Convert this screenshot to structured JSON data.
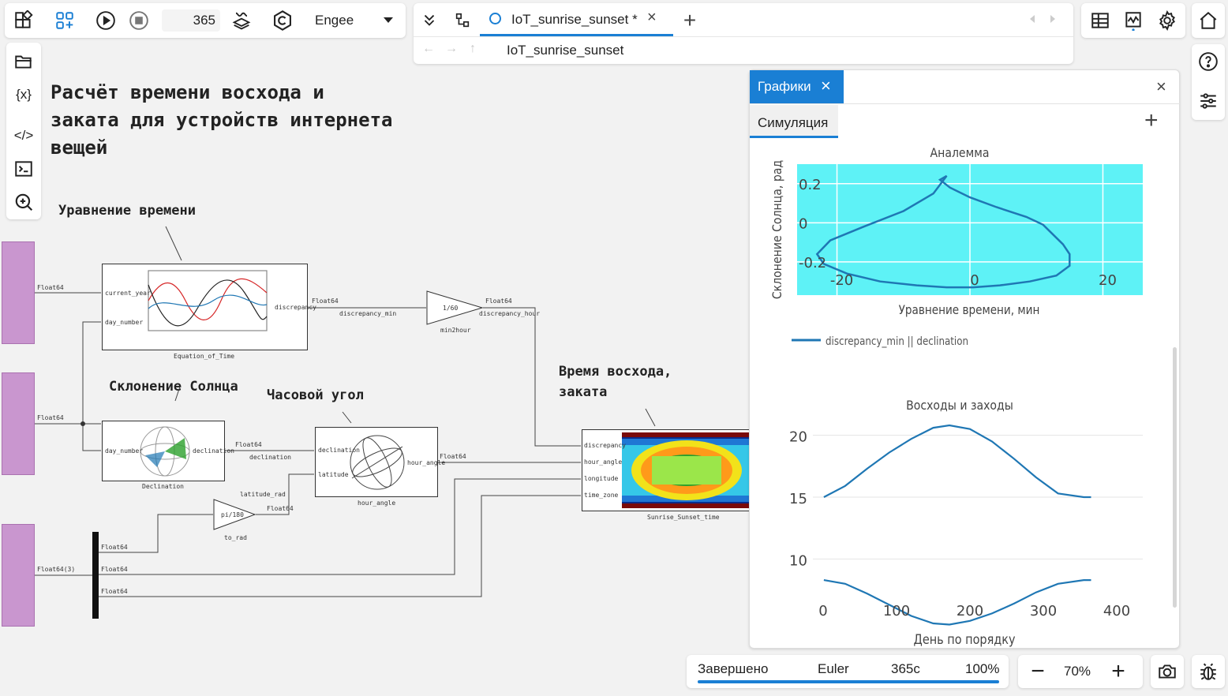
{
  "toolbar": {
    "steps_value": "365",
    "solver_engine": "Engee",
    "tab_label": "IoT_sunrise_sunset *",
    "breadcrumb": "IoT_sunrise_sunset"
  },
  "canvas": {
    "title": "Расчёт времени восхода и заката для устройств интернета вещей",
    "title_lines": [
      "Расчёт времени восхода и",
      "заката для устройств интернета",
      "вещей"
    ],
    "comments": {
      "equation_of_time": "Уравнение времени",
      "declination": "Склонение Солнца",
      "hour_angle": "Часовой угол",
      "sunrise_lines": [
        "Время восхода,",
        "заката"
      ]
    },
    "blocks": {
      "equation_of_time": {
        "name": "Equation_of_Time",
        "in1": "current_year",
        "in2": "day_number",
        "out": "discrepancy"
      },
      "min2hour": {
        "name": "min2hour",
        "gain": "1/60"
      },
      "declination": {
        "name": "Declination",
        "in": "day_number",
        "out": "declination"
      },
      "hour_angle": {
        "name": "hour_angle",
        "in1": "declination",
        "in2": "latitude",
        "out": "hour_angle"
      },
      "to_rad": {
        "name": "to_rad",
        "gain": "pi/180"
      },
      "sunrise": {
        "name": "Sunrise_Sunset_time",
        "in1": "discrepancy",
        "in2": "hour_angle",
        "in3": "longitude",
        "in4": "time_zone"
      }
    },
    "signals": {
      "float64": "Float64",
      "float64_3": "Float64(3)",
      "discrepancy_min": "discrepancy_min",
      "discrepancy_hour": "discrepancy_hour",
      "declination": "declination",
      "latitude_rad": "latitude_rad"
    }
  },
  "plots_panel": {
    "tab_label": "Графики",
    "subtab_label": "Симуляция",
    "chart_data": [
      {
        "type": "line",
        "title": "Аналемма",
        "xlabel": "Уравнение времени, мин",
        "ylabel": "Склонение Солнца, рад",
        "xticks": [
          "-20",
          "0",
          "20"
        ],
        "yticks": [
          "0.2",
          "0",
          "-0.2"
        ],
        "legend": "discrepancy_min || declination",
        "background": "#5ef2f6",
        "series": [
          {
            "name": "discrepancy_min || declination",
            "color": "#1f77b4",
            "x": [
              -3.5,
              -4.5,
              -3.0,
              0.0,
              4.0,
              8.5,
              11.0,
              12.5,
              14.0,
              15.0,
              15.0,
              13.0,
              9.0,
              4.5,
              0.5,
              -3.5,
              -8.0,
              -13.5,
              -18.5,
              -22.0,
              -23.0,
              -21.0,
              -16.0,
              -10.0,
              -5.5,
              -3.5
            ],
            "y": [
              0.24,
              0.22,
              0.18,
              0.13,
              0.08,
              0.03,
              -0.01,
              -0.06,
              -0.11,
              -0.16,
              -0.22,
              -0.27,
              -0.3,
              -0.32,
              -0.33,
              -0.33,
              -0.32,
              -0.3,
              -0.26,
              -0.21,
              -0.16,
              -0.09,
              -0.02,
              0.06,
              0.15,
              0.24
            ]
          }
        ]
      },
      {
        "type": "line",
        "title": "Восходы и заходы",
        "xlabel": "День по порядку",
        "ylabel": "",
        "xticks": [
          "0",
          "100",
          "200",
          "300",
          "400"
        ],
        "yticks": [
          "20",
          "15",
          "10"
        ],
        "xlim": [
          0,
          400
        ],
        "ylim": [
          6.2,
          21.5
        ],
        "series": [
          {
            "color": "#1f77b4",
            "x": [
              1,
              30,
              60,
              90,
              120,
              150,
              172,
              200,
              230,
              260,
              290,
              320,
              355,
              365
            ],
            "y": [
              15.0,
              15.9,
              17.3,
              18.6,
              19.7,
              20.6,
              20.8,
              20.5,
              19.5,
              18.1,
              16.6,
              15.3,
              15.0,
              15.0
            ]
          },
          {
            "color": "#1f77b4",
            "x": [
              1,
              30,
              60,
              90,
              120,
              150,
              172,
              200,
              230,
              260,
              290,
              320,
              355,
              365
            ],
            "y": [
              8.3,
              8.0,
              7.2,
              6.3,
              5.4,
              4.8,
              4.7,
              5.0,
              5.6,
              6.4,
              7.3,
              8.0,
              8.3,
              8.3
            ]
          }
        ]
      }
    ]
  },
  "statusbar": {
    "status": "Завершено",
    "solver": "Euler",
    "sim_time": "365с",
    "progress_text": "100%",
    "progress": 1.0,
    "zoom": "70%"
  }
}
